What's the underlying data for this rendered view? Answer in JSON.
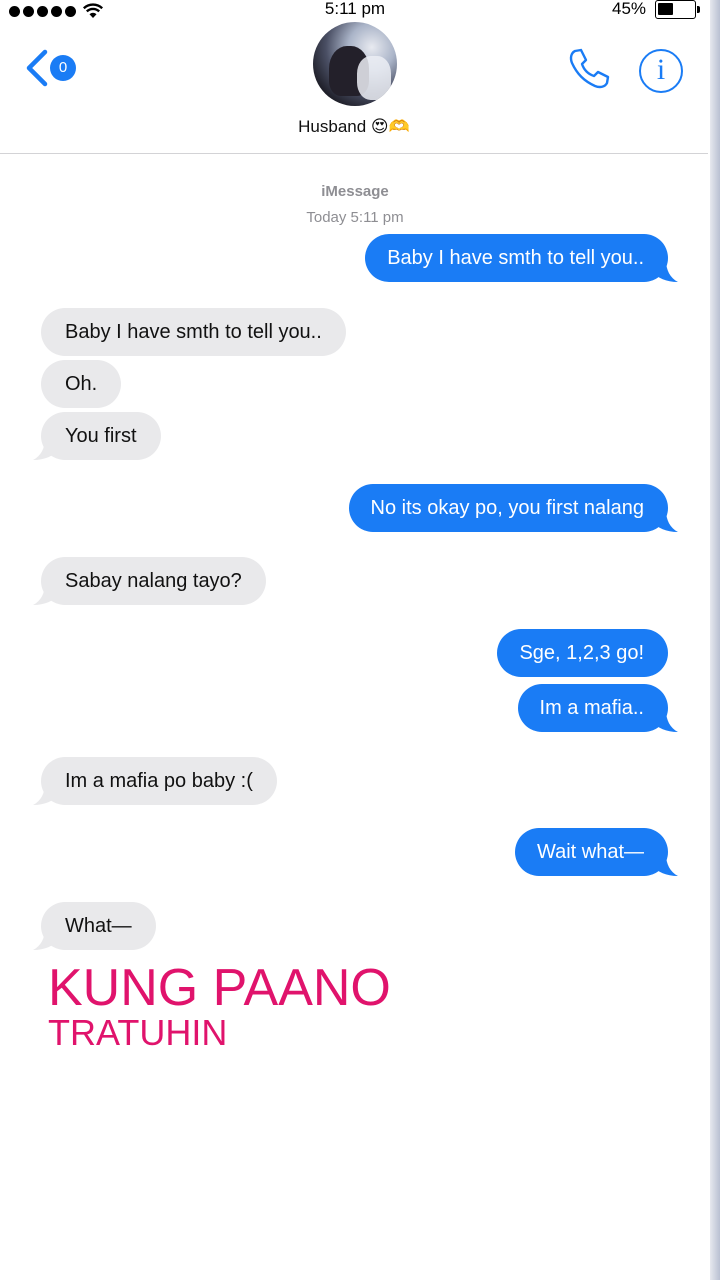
{
  "status_bar": {
    "time": "5:11 pm",
    "battery": "45%"
  },
  "header": {
    "unread_count": "0",
    "contact_name": "Husband 😍🫶"
  },
  "thread": {
    "service": "iMessage",
    "timestamp": "Today 5:11 pm"
  },
  "messages": [
    {
      "text": "Baby I have smth to tell you..",
      "direction": "sent"
    },
    {
      "text": "Baby I have smth to tell you..",
      "direction": "received"
    },
    {
      "text": "Oh.",
      "direction": "received"
    },
    {
      "text": "You first",
      "direction": "received"
    },
    {
      "text": "No its okay po, you first nalang",
      "direction": "sent"
    },
    {
      "text": "Sabay nalang tayo?",
      "direction": "received"
    },
    {
      "text": "Sge, 1,2,3 go!",
      "direction": "sent"
    },
    {
      "text": "Im a mafia..",
      "direction": "sent"
    },
    {
      "text": "Im a mafia po baby :(",
      "direction": "received"
    },
    {
      "text": "Wait what—",
      "direction": "sent"
    },
    {
      "text": "What—",
      "direction": "received"
    }
  ],
  "overlay": {
    "line1": "KUNG PAANO",
    "line2": "TRATUHIN"
  },
  "colors": {
    "accent": "#1a7cf5",
    "received_bubble": "#e9e9eb",
    "overlay_text": "#e0136c"
  },
  "icons": [
    "wifi-icon",
    "battery-icon",
    "back-chevron-icon",
    "phone-icon",
    "info-icon"
  ]
}
